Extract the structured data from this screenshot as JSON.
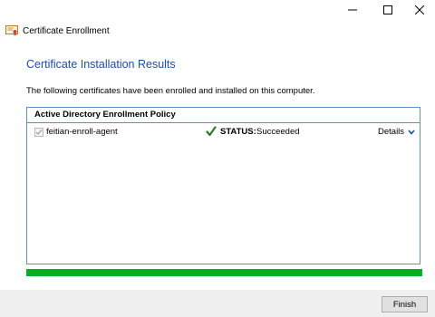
{
  "window": {
    "title": "Certificate Enrollment",
    "controls": {
      "minimize_icon": "minimize-icon",
      "maximize_icon": "maximize-icon",
      "close_icon": "close-icon"
    }
  },
  "page": {
    "title": "Certificate Installation Results",
    "description": "The following certificates have been enrolled and installed on this computer."
  },
  "results": {
    "policy_header": "Active Directory Enrollment Policy",
    "items": [
      {
        "name": "feitian-enroll-agent",
        "checked": true,
        "status_label": "STATUS:",
        "status_value": "Succeeded",
        "details_label": "Details"
      }
    ]
  },
  "progress": {
    "percent": 100,
    "color": "#06b025"
  },
  "footer": {
    "finish_label": "Finish"
  },
  "colors": {
    "title_blue": "#1f4e99",
    "panel_border": "#5b8fd1",
    "success_green": "#06b025"
  }
}
